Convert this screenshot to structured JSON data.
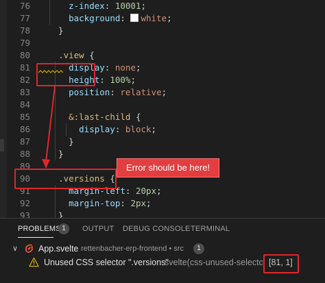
{
  "editor": {
    "lines": [
      {
        "n": "76",
        "parts": [
          {
            "t": "    "
          },
          {
            "t": "z-index",
            "c": "prop"
          },
          {
            "t": ": "
          },
          {
            "t": "10001",
            "c": "num"
          },
          {
            "t": ";"
          }
        ]
      },
      {
        "n": "77",
        "parts": [
          {
            "t": "    "
          },
          {
            "t": "background",
            "c": "prop"
          },
          {
            "t": ": "
          },
          {
            "swatch": true
          },
          {
            "t": "white",
            "c": "val"
          },
          {
            "t": ";"
          }
        ]
      },
      {
        "n": "78",
        "parts": [
          {
            "t": "  }"
          }
        ]
      },
      {
        "n": "79",
        "parts": [
          {
            "t": ""
          }
        ]
      },
      {
        "n": "80",
        "parts": [
          {
            "t": "  "
          },
          {
            "t": ".view",
            "c": "sel"
          },
          {
            "t": " {"
          }
        ]
      },
      {
        "n": "81",
        "parts": [
          {
            "t": "    "
          },
          {
            "t": "display",
            "c": "prop"
          },
          {
            "t": ": "
          },
          {
            "t": "none",
            "c": "val"
          },
          {
            "t": ";"
          }
        ]
      },
      {
        "n": "82",
        "parts": [
          {
            "t": "    "
          },
          {
            "t": "height",
            "c": "prop"
          },
          {
            "t": ": "
          },
          {
            "t": "100%",
            "c": "num"
          },
          {
            "t": ";"
          }
        ]
      },
      {
        "n": "83",
        "parts": [
          {
            "t": "    "
          },
          {
            "t": "position",
            "c": "prop"
          },
          {
            "t": ": "
          },
          {
            "t": "relative",
            "c": "val"
          },
          {
            "t": ";"
          }
        ]
      },
      {
        "n": "84",
        "parts": [
          {
            "t": ""
          }
        ]
      },
      {
        "n": "85",
        "parts": [
          {
            "t": "    "
          },
          {
            "t": "&:last-child",
            "c": "sel"
          },
          {
            "t": " {"
          }
        ]
      },
      {
        "n": "86",
        "parts": [
          {
            "t": "      "
          },
          {
            "t": "display",
            "c": "prop"
          },
          {
            "t": ": "
          },
          {
            "t": "block",
            "c": "val"
          },
          {
            "t": ";"
          }
        ]
      },
      {
        "n": "87",
        "parts": [
          {
            "t": "    }"
          }
        ]
      },
      {
        "n": "88",
        "parts": [
          {
            "t": "  }"
          }
        ]
      },
      {
        "n": "89",
        "parts": [
          {
            "t": ""
          }
        ]
      },
      {
        "n": "90",
        "parts": [
          {
            "t": "  "
          },
          {
            "t": ".versions",
            "c": "sel"
          },
          {
            "t": " {"
          }
        ]
      },
      {
        "n": "91",
        "parts": [
          {
            "t": "    "
          },
          {
            "t": "margin-left",
            "c": "prop"
          },
          {
            "t": ": "
          },
          {
            "t": "20px",
            "c": "num"
          },
          {
            "t": ";"
          }
        ]
      },
      {
        "n": "92",
        "parts": [
          {
            "t": "    "
          },
          {
            "t": "margin-top",
            "c": "prop"
          },
          {
            "t": ": "
          },
          {
            "t": "2px",
            "c": "num"
          },
          {
            "t": ";"
          }
        ]
      },
      {
        "n": "93",
        "parts": [
          {
            "t": "  }"
          }
        ]
      }
    ]
  },
  "annotation": {
    "callout_text": "Error should be here!",
    "accent_color": "#e0262a"
  },
  "panel": {
    "tabs": [
      {
        "label": "PROBLEMS",
        "active": true
      },
      {
        "label": "OUTPUT",
        "active": false
      },
      {
        "label": "DEBUG CONSOLE",
        "active": false
      },
      {
        "label": "TERMINAL",
        "active": false
      }
    ],
    "problems_count": "1",
    "file": {
      "name": "App.svelte",
      "path": "rettenbacher-erp-frontend • src",
      "count": "1",
      "icon": "svelte-icon"
    },
    "problem": {
      "icon": "warning-icon",
      "message": "Unused CSS selector \".versions\"",
      "source": "svelte(css-unused-selector)",
      "position": "[81, 1]"
    }
  }
}
